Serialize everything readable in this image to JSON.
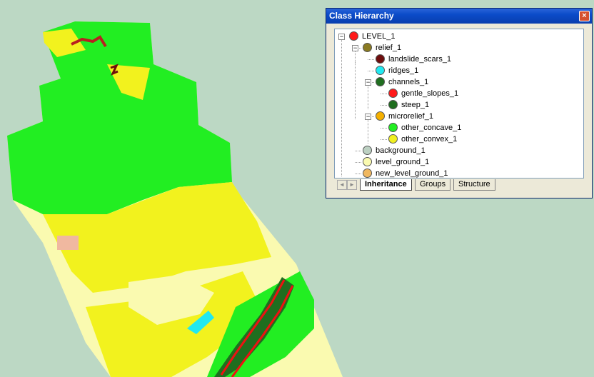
{
  "window": {
    "title": "Class Hierarchy",
    "close_glyph": "×"
  },
  "tree": [
    {
      "label": "LEVEL_1",
      "color": "#ff1a1a",
      "expander": "−"
    },
    {
      "label": "relief_1",
      "color": "#8a7a22",
      "expander": "−"
    },
    {
      "label": "landslide_scars_1",
      "color": "#6e0d0d"
    },
    {
      "label": "ridges_1",
      "color": "#22e8f0"
    },
    {
      "label": "channels_1",
      "color": "#1f6e1f",
      "expander": "−"
    },
    {
      "label": "gentle_slopes_1",
      "color": "#ff1a1a"
    },
    {
      "label": "steep_1",
      "color": "#1f6e1f"
    },
    {
      "label": "microrelief_1",
      "color": "#f5b000",
      "expander": "−"
    },
    {
      "label": "other_concave_1",
      "color": "#22ee22"
    },
    {
      "label": "other_convex_1",
      "color": "#f0f020"
    },
    {
      "label": "background_1",
      "color": "#bcd0c2"
    },
    {
      "label": "level_ground_1",
      "color": "#fafab0"
    },
    {
      "label": "new_level_ground_1",
      "color": "#f0b860"
    }
  ],
  "tabs": [
    "Inheritance",
    "Groups",
    "Structure"
  ],
  "active_tab": "Inheritance",
  "nav": {
    "prev": "◄",
    "next": "►"
  },
  "colors": {
    "background": "#bcd8c4",
    "green": "#22ee22",
    "yellow": "#f2f21e",
    "light_yellow": "#fafab0",
    "dark_green": "#1f6e1f",
    "red": "#ee1111",
    "salmon": "#f0b8a0",
    "cyan": "#22e8f0",
    "dark_red": "#6e0d0d"
  }
}
